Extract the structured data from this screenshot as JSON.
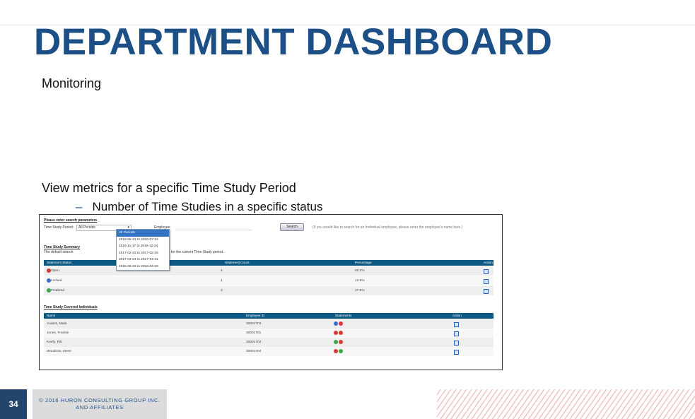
{
  "slide": {
    "title": "DEPARTMENT DASHBOARD",
    "subtitle": "Monitoring",
    "bullet_1": "View metrics for a specific Time Study Period",
    "bullet_2_dash": "–",
    "bullet_2": "Number of Time Studies in a specific status",
    "page_number": "34",
    "copyright_line1": "© 2016 HURON CONSULTING GROUP INC.",
    "copyright_line2": "AND AFFILIATES"
  },
  "screenshot": {
    "search_heading": "Please enter search parameters",
    "period_label": "Time Study Period:",
    "period_value": "All Periods",
    "employee_label": "Employee:",
    "search_button": "Search",
    "search_hint": "(If you would like to search for an Individual employee, please enter the employee's name here.)",
    "dropdown_options": [
      "All Periods",
      "2016-05-31 to 2016-07-24",
      "2016-11-17 to 2016-12-24",
      "2017-02-23 to 2017-02-25",
      "2017-03-24 to 2017-04-21",
      "2016-06-23 to 2016-04-29"
    ],
    "summary_heading": "Time Study Summary",
    "summary_note_left": "The default search",
    "summary_note_right": "for the current Time Study period.",
    "status_table": {
      "headers": [
        "Statement Status",
        "Statement Count",
        "Percentage",
        "Action"
      ],
      "rows": [
        {
          "status": "Open, Not Finalized",
          "count": "4",
          "percent": "50.0%",
          "icon_color": "#d83a3a"
        },
        {
          "status": "Locked",
          "count": "1",
          "percent": "12.5%",
          "icon_color": "#3a6fcf"
        },
        {
          "status": "Finalized",
          "count": "3",
          "percent": "37.5%",
          "icon_color": "#3aa84a"
        }
      ]
    },
    "individuals_heading": "Time Study Covered Individuals",
    "individuals_table": {
      "headers": [
        "Name",
        "Employee ID",
        "Statements",
        "Action"
      ],
      "rows": [
        {
          "name": "Anders, Mark",
          "id": "30001703"
        },
        {
          "name": "Jones, Frankie",
          "id": "30001701"
        },
        {
          "name": "Keefy, Pitt",
          "id": "30001702"
        },
        {
          "name": "Woodrow, Steve",
          "id": "30001704"
        }
      ]
    }
  },
  "colors": {
    "title": "#1b4f86",
    "table_header": "#0c5a84",
    "page_box": "#23456b",
    "hatch": "#f3c4c4"
  }
}
